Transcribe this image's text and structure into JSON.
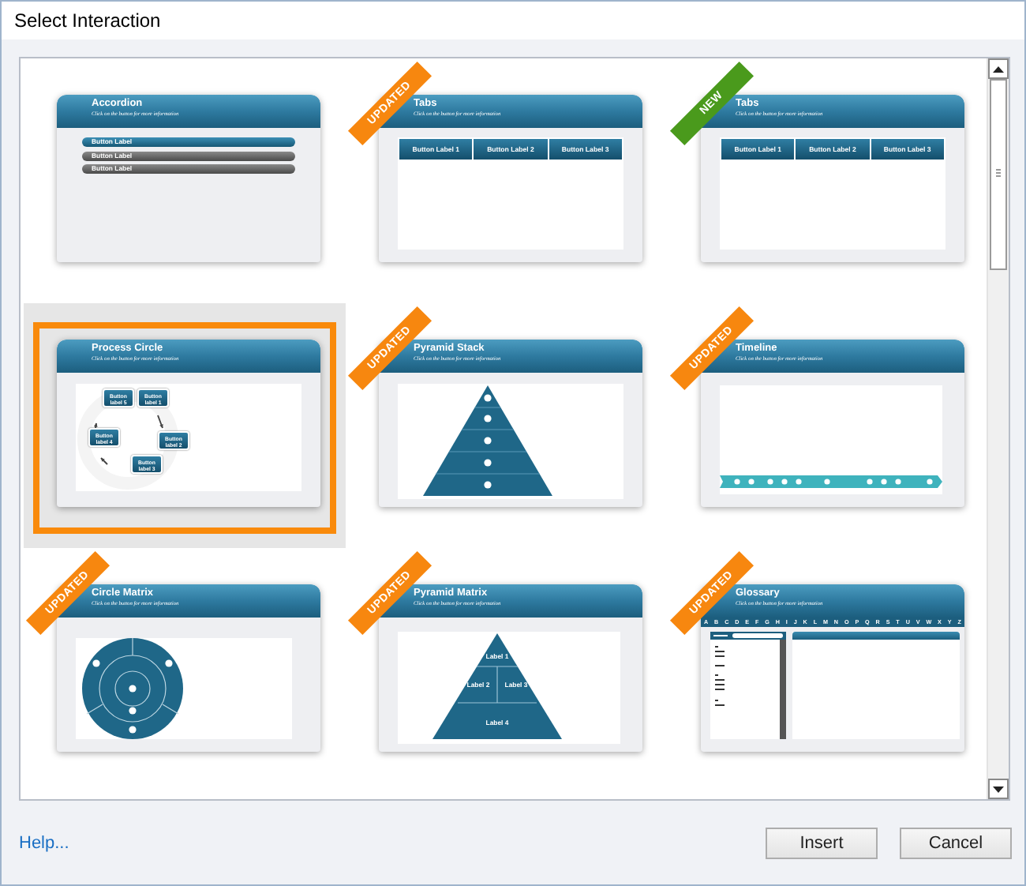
{
  "window": {
    "title": "Select Interaction"
  },
  "interactions": [
    {
      "kind": "accordion",
      "title": "Accordion",
      "subtitle": "Click on the button for more information",
      "selected": false,
      "items": [
        {
          "label": "Button Label",
          "selected": true
        },
        {
          "label": "Button Label",
          "selected": false
        },
        {
          "label": "Button Label",
          "selected": false
        }
      ]
    },
    {
      "kind": "tabs",
      "title": "Tabs",
      "subtitle": "Click on the button for more information",
      "selected": false,
      "ribbon": {
        "label": "UPDATED",
        "color": "#f7870f"
      },
      "items": [
        {
          "label": "Button Label 1"
        },
        {
          "label": "Button Label 2"
        },
        {
          "label": "Button Label 3"
        }
      ]
    },
    {
      "kind": "tabs",
      "title": "Tabs",
      "subtitle": "Click on the button for more information",
      "selected": false,
      "ribbon": {
        "label": "NEW",
        "color": "#4a9a1c"
      },
      "items": [
        {
          "label": "Button Label 1"
        },
        {
          "label": "Button Label 2"
        },
        {
          "label": "Button Label 3"
        }
      ]
    },
    {
      "kind": "process",
      "title": "Process Circle",
      "subtitle": "Click on the button for more information",
      "selected": true,
      "items": [
        {
          "label": "Button label 5"
        },
        {
          "label": "Button label 1"
        },
        {
          "label": "Button label 4"
        },
        {
          "label": "Button label 2"
        },
        {
          "label": "Button label 3"
        }
      ]
    },
    {
      "kind": "pyramid",
      "title": "Pyramid Stack",
      "subtitle": "Click on the button for more information",
      "selected": false,
      "ribbon": {
        "label": "UPDATED",
        "color": "#f7870f"
      }
    },
    {
      "kind": "timeline",
      "title": "Timeline",
      "subtitle": "Click on the button for more information",
      "selected": false,
      "ribbon": {
        "label": "UPDATED",
        "color": "#f7870f"
      }
    },
    {
      "kind": "circle",
      "title": "Circle Matrix",
      "subtitle": "Click on the button for more information",
      "selected": false,
      "ribbon": {
        "label": "UPDATED",
        "color": "#f7870f"
      }
    },
    {
      "kind": "pyramid-matrix",
      "title": "Pyramid Matrix",
      "subtitle": "Click on the button for more information",
      "selected": false,
      "ribbon": {
        "label": "UPDATED",
        "color": "#f7870f"
      },
      "items": [
        {
          "label": "Label 1"
        },
        {
          "label": "Label 2"
        },
        {
          "label": "Label 3"
        },
        {
          "label": "Label 4"
        }
      ]
    },
    {
      "kind": "glossary",
      "title": "Glossary",
      "subtitle": "Click on the button for more information",
      "selected": false,
      "ribbon": {
        "label": "UPDATED",
        "color": "#f7870f"
      },
      "letters": [
        "A",
        "B",
        "C",
        "D",
        "E",
        "F",
        "G",
        "H",
        "I",
        "J",
        "K",
        "L",
        "M",
        "N",
        "O",
        "P",
        "Q",
        "R",
        "S",
        "T",
        "U",
        "V",
        "W",
        "X",
        "Y",
        "Z"
      ]
    }
  ],
  "help_link": "Help...",
  "buttons": [
    "Insert",
    "Cancel"
  ]
}
